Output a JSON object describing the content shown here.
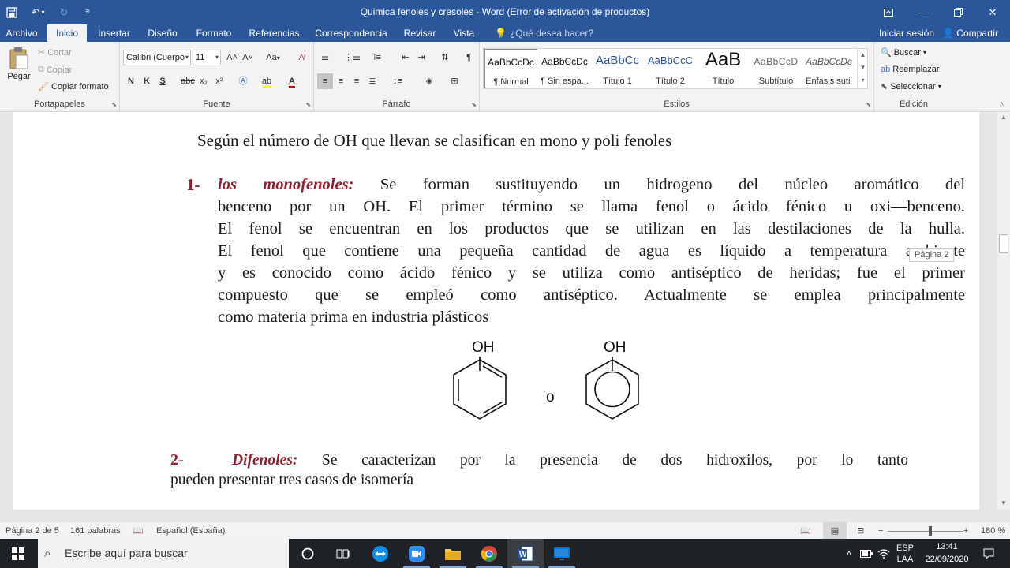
{
  "window": {
    "title": "Quimica fenoles y cresoles - Word (Error de activación de productos)"
  },
  "tabs": [
    "Archivo",
    "Inicio",
    "Insertar",
    "Diseño",
    "Formato",
    "Referencias",
    "Correspondencia",
    "Revisar",
    "Vista"
  ],
  "tellme_placeholder": "¿Qué desea hacer?",
  "account": {
    "signin": "Iniciar sesión",
    "share": "Compartir"
  },
  "ribbon": {
    "clipboard": {
      "label": "Portapapeles",
      "paste": "Pegar",
      "cut": "Cortar",
      "copy": "Copiar",
      "format_painter": "Copiar formato"
    },
    "font": {
      "label": "Fuente",
      "family": "Calibri (Cuerpo",
      "size": "11",
      "bold": "N",
      "italic": "K",
      "underline": "S",
      "strike": "abc",
      "sub": "x₂",
      "sup": "x²",
      "grow": "A˄",
      "shrink": "A˅",
      "case": "Aa"
    },
    "paragraph": {
      "label": "Párrafo"
    },
    "styles": {
      "label": "Estilos",
      "items": [
        {
          "preview": "AaBbCcDc",
          "name": "¶ Normal"
        },
        {
          "preview": "AaBbCcDc",
          "name": "¶ Sin espa..."
        },
        {
          "preview": "AaBbCc",
          "name": "Título 1"
        },
        {
          "preview": "AaBbCcC",
          "name": "Título 2"
        },
        {
          "preview": "AaB",
          "name": "Título"
        },
        {
          "preview": "AaBbCcD",
          "name": "Subtítulo"
        },
        {
          "preview": "AaBbCcDc",
          "name": "Énfasis sutil"
        }
      ]
    },
    "editing": {
      "label": "Edición",
      "find": "Buscar",
      "replace": "Reemplazar",
      "select": "Seleccionar"
    }
  },
  "document": {
    "heading": "Según el número de OH que llevan se clasifican en mono y poli fenoles",
    "item1": {
      "number": "1-",
      "term": "los monofenoles:",
      "first_line_rest": "Se forman sustituyendo un hidrogeno del núcleo aromático del",
      "lines": [
        "benceno por un OH. El primer término se llama fenol o ácido fénico u oxi—benceno.",
        "El fenol se encuentran en los productos que se utilizan en las destilaciones de la hulla.",
        "El fenol que contiene una pequeña cantidad de agua es líquido a temperatura ambiente",
        "y es conocido como ácido fénico y se utiliza como antiséptico de heridas; fue el primer",
        "compuesto que se empleó como antiséptico. Actualmente se emplea principalmente",
        "como materia prima en industria plásticos"
      ]
    },
    "structure": {
      "oh_left": "OH",
      "oh_right": "OH",
      "separator": "o"
    },
    "item2": {
      "number": "2-",
      "term": "Difenoles:",
      "first_line_rest": "Se caracterizan por la presencia de dos hidroxilos, por lo tanto",
      "line2": "pueden presentar tres casos de isomería"
    },
    "tooltip": "Página 2"
  },
  "statusbar": {
    "page": "Página 2 de 5",
    "words": "161 palabras",
    "language": "Español (España)",
    "zoom": "180 %"
  },
  "taskbar": {
    "search_placeholder": "Escribe aquí para buscar",
    "lang1": "ESP",
    "lang2": "LAA",
    "time": "13:41",
    "date": "22/09/2020"
  },
  "colors": {
    "word_blue": "#2b579a",
    "term_red": "#8e2131"
  }
}
